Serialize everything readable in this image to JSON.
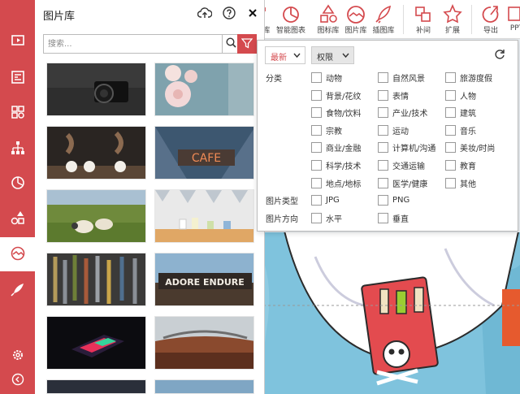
{
  "toolbar": {
    "items": [
      {
        "label": "库",
        "icon": "text-icon"
      },
      {
        "label": "智能图表",
        "icon": "pie-chart-icon"
      },
      {
        "label": "图标库",
        "icon": "shapes-icon"
      },
      {
        "label": "图片库",
        "icon": "image-icon"
      },
      {
        "label": "插图库",
        "icon": "rocket-icon"
      },
      {
        "label": "补间",
        "icon": "tween-icon"
      },
      {
        "label": "扩展",
        "icon": "star-icon"
      },
      {
        "label": "导出",
        "icon": "export-icon"
      },
      {
        "label": "PPT",
        "icon": "ppt-icon"
      }
    ]
  },
  "sidebar": {
    "items": [
      {
        "icon": "slideshow-icon"
      },
      {
        "icon": "article-icon"
      },
      {
        "icon": "grid-blocks-icon"
      },
      {
        "icon": "org-chart-icon"
      },
      {
        "icon": "pie-chart-icon"
      },
      {
        "icon": "shapes-icon"
      },
      {
        "icon": "image-gallery-icon",
        "active": true
      },
      {
        "icon": "rocket-icon"
      }
    ],
    "bottom": [
      {
        "icon": "gear-icon"
      },
      {
        "icon": "collapse-left-icon"
      }
    ]
  },
  "gallery": {
    "title": "图片库",
    "search_placeholder": "搜索...",
    "thumbnails": [
      {
        "subject": "camera"
      },
      {
        "subject": "flowers"
      },
      {
        "subject": "coffee-pour"
      },
      {
        "subject": "cafe-sign"
      },
      {
        "subject": "sheep"
      },
      {
        "subject": "shelf"
      },
      {
        "subject": "tools"
      },
      {
        "subject": "shop-sign"
      },
      {
        "subject": "glowing-device"
      },
      {
        "subject": "car-dashboard"
      }
    ]
  },
  "filter": {
    "sort_value": "最新",
    "perm_value": "权限",
    "category_label": "分类",
    "categories": [
      [
        "动物",
        "自然风景",
        "旅游度假"
      ],
      [
        "背景/花纹",
        "表情",
        "人物"
      ],
      [
        "食物/饮料",
        "产业/技术",
        "建筑"
      ],
      [
        "宗教",
        "运动",
        "音乐"
      ],
      [
        "商业/金融",
        "计算机/沟通",
        "美妆/时尚"
      ],
      [
        "科学/技术",
        "交通运输",
        "教育"
      ],
      [
        "地点/地标",
        "医学/健康",
        "其他"
      ]
    ],
    "type_label": "图片类型",
    "types": [
      "JPG",
      "PNG"
    ],
    "orient_label": "图片方向",
    "orients": [
      "水平",
      "垂直"
    ]
  },
  "colors": {
    "accent": "#d44a4e"
  }
}
